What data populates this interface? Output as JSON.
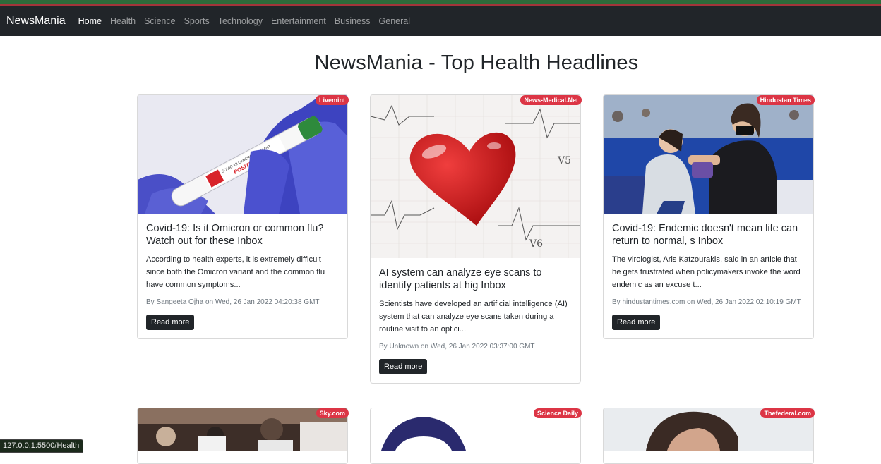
{
  "navbar": {
    "brand": "NewsMania",
    "links": [
      "Home",
      "Health",
      "Science",
      "Sports",
      "Technology",
      "Entertainment",
      "Business",
      "General"
    ],
    "active": "Home"
  },
  "page": {
    "title": "NewsMania - Top Health Headlines"
  },
  "cards": [
    {
      "source": "Livemint",
      "title": "Covid-19: Is it Omicron or common flu? Watch out for these Inbox",
      "description": "According to health experts, it is extremely difficult since both the Omicron variant and the common flu have common symptoms...",
      "meta": "By Sangeeta Ojha on Wed, 26 Jan 2022 04:20:38 GMT",
      "button": "Read more",
      "image_text": [
        "COVID-19 OMICRON VARIANT",
        "POSITIVE"
      ]
    },
    {
      "source": "News-Medical.Net",
      "title": "AI system can analyze eye scans to identify patients at hig Inbox",
      "description": "Scientists have developed an artificial intelligence (AI) system that can analyze eye scans taken during a routine visit to an optici...",
      "meta": "By Unknown on Wed, 26 Jan 2022 03:37:00 GMT",
      "button": "Read more",
      "image_text": [
        "V5",
        "V6"
      ]
    },
    {
      "source": "Hindustan Times",
      "title": "Covid-19: Endemic doesn't mean life can return to normal, s Inbox",
      "description": "The virologist, Aris Katzourakis, said in an article that he gets frustrated when policymakers invoke the word endemic as an excuse t...",
      "meta": "By hindustantimes.com on Wed, 26 Jan 2022 02:10:19 GMT",
      "button": "Read more"
    },
    {
      "source": "Sky.com"
    },
    {
      "source": "Science Daily"
    },
    {
      "source": "Thefederal.com"
    }
  ],
  "status_bar": {
    "url": "127.0.0.1:5500/Health"
  },
  "colors": {
    "navbar_bg": "#212529",
    "badge_bg": "#dc3545",
    "button_bg": "#212529"
  }
}
